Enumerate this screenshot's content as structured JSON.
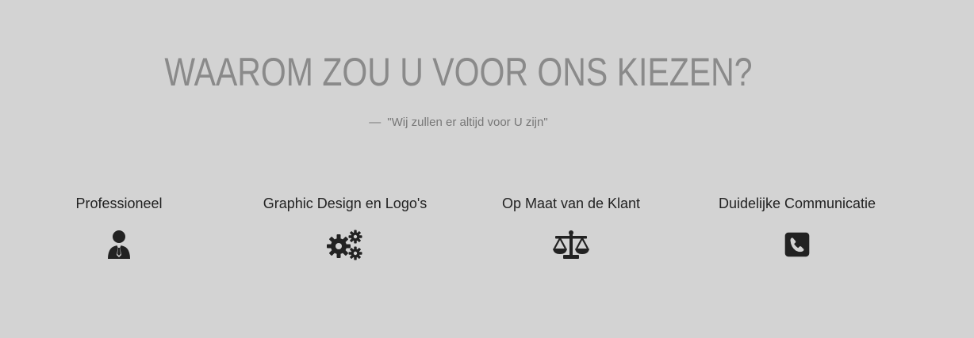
{
  "section": {
    "heading": "WAAROM ZOU U VOOR ONS KIEZEN?",
    "tagline_dash": "—",
    "tagline": "\"Wij zullen er altijd voor U zijn\""
  },
  "features": [
    {
      "title": "Professioneel",
      "icon": "user-tie-icon"
    },
    {
      "title": "Graphic Design en Logo's",
      "icon": "cogs-icon"
    },
    {
      "title": "Op Maat van de Klant",
      "icon": "balance-scale-icon"
    },
    {
      "title": "Duidelijke Communicatie",
      "icon": "phone-square-icon"
    }
  ],
  "colors": {
    "background": "#d3d3d3",
    "heading": "#8a8a8a",
    "tagline": "#777777",
    "text": "#222222",
    "icon": "#222222"
  }
}
